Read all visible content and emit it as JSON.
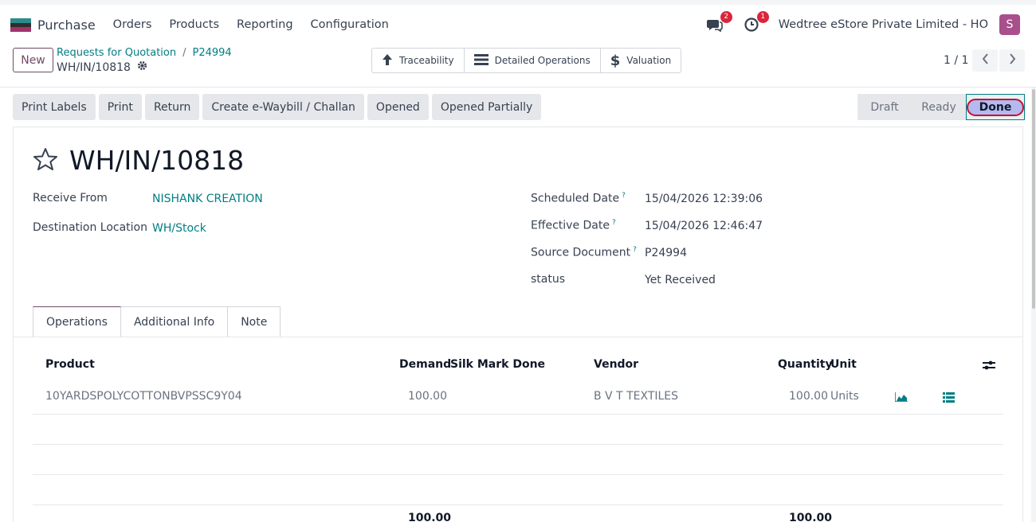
{
  "app": {
    "name": "Purchase",
    "nav": [
      "Orders",
      "Products",
      "Reporting",
      "Configuration"
    ],
    "chat_badge": "2",
    "activity_badge": "1",
    "company": "Wedtree eStore Private Limited - HO",
    "avatar_letter": "S"
  },
  "control": {
    "new_label": "New",
    "breadcrumb": [
      "Requests for Quotation",
      "P24994"
    ],
    "record": "WH/IN/10818",
    "smart_buttons": [
      "Traceability",
      "Detailed Operations",
      "Valuation"
    ],
    "pager": "1 / 1"
  },
  "actions": [
    "Print Labels",
    "Print",
    "Return",
    "Create e-Waybill / Challan",
    "Opened",
    "Opened Partially"
  ],
  "status": {
    "stages": [
      "Draft",
      "Ready",
      "Done"
    ],
    "current": "Done"
  },
  "form": {
    "title": "WH/IN/10818",
    "receive_from_label": "Receive From",
    "receive_from": "NISHANK CREATION",
    "dest_label": "Destination Location",
    "dest": "WH/Stock",
    "scheduled_label": "Scheduled Date",
    "scheduled": "15/04/2026 12:39:06",
    "effective_label": "Effective Date",
    "effective": "15/04/2026 12:46:47",
    "source_label": "Source Document",
    "source": "P24994",
    "status_label": "status",
    "status_value": "Yet Received",
    "help_mark": "?"
  },
  "tabs": [
    "Operations",
    "Additional Info",
    "Note"
  ],
  "table": {
    "headers": {
      "product": "Product",
      "demand": "Demand",
      "silk": "Silk Mark Done",
      "vendor": "Vendor",
      "quantity": "Quantity",
      "unit": "Unit"
    },
    "row": {
      "product": "10YARDSPOLYCOTTONBVPSSC9Y04",
      "demand": "100.00",
      "vendor": "B V T TEXTILES",
      "quantity": "100.00",
      "unit": "Units"
    },
    "total_demand": "100.00",
    "total_quantity": "100.00"
  },
  "colors": {
    "brand": "#714b67",
    "link": "#017e84",
    "badge": "#d9263b"
  }
}
